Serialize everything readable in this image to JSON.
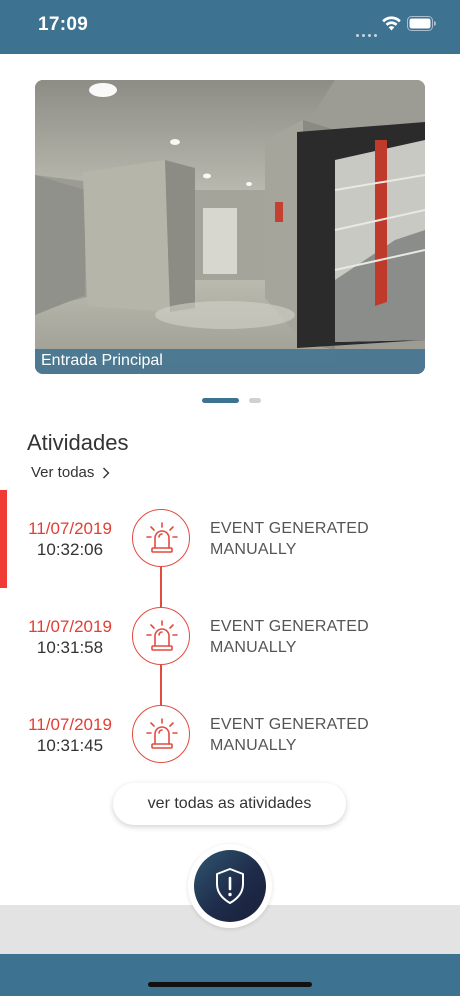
{
  "status_bar": {
    "time": "17:09",
    "icons": [
      "signal-dots-icon",
      "wifi-icon",
      "battery-icon"
    ]
  },
  "camera": {
    "caption": "Entrada Principal"
  },
  "carousel": {
    "pages": 2,
    "active_page": 1
  },
  "activities": {
    "title": "Atividades",
    "view_all_label": "Ver todas",
    "events": [
      {
        "date": "11/07/2019",
        "time": "10:32:06",
        "line1": "EVENT GENERATED",
        "line2": "MANUALLY",
        "icon": "siren-icon"
      },
      {
        "date": "11/07/2019",
        "time": "10:31:58",
        "line1": "EVENT GENERATED",
        "line2": "MANUALLY",
        "icon": "siren-icon"
      },
      {
        "date": "11/07/2019",
        "time": "10:31:45",
        "line1": "EVENT GENERATED",
        "line2": "MANUALLY",
        "icon": "siren-icon"
      }
    ],
    "all_activities_button": "ver todas as atividades"
  },
  "panic_button": {
    "icon": "shield-alert-icon"
  },
  "colors": {
    "primary": "#3e7291",
    "accent_red": "#e23e34",
    "panic_dark": "#1e2c4a"
  }
}
